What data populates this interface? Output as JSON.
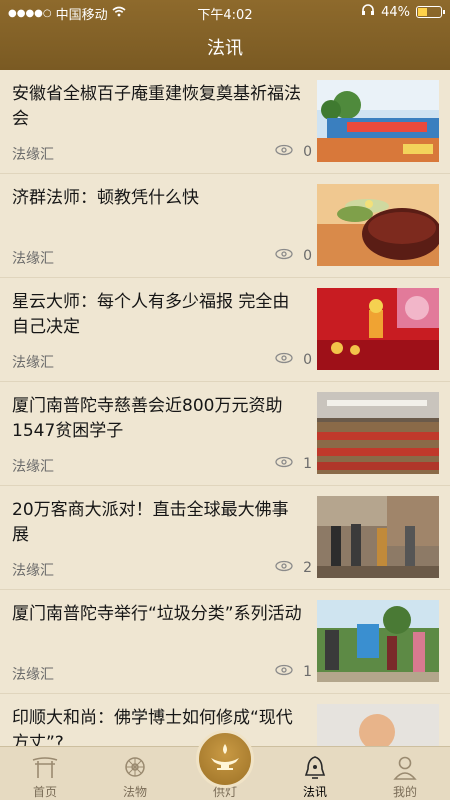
{
  "status_bar": {
    "signal": "●●●●○",
    "carrier": "中国移动",
    "time": "下午4:02",
    "battery": "44%",
    "battery_level": 0.44
  },
  "nav": {
    "title": "法讯"
  },
  "articles": [
    {
      "title": "安徽省全椒百子庵重建恢复奠基祈福法会",
      "source": "法缘汇",
      "views": "0",
      "thumb_icon": "ceremony-photo"
    },
    {
      "title": "济群法师：顿教凭什么快",
      "source": "法缘汇",
      "views": "0",
      "thumb_icon": "lotus-bowl-photo"
    },
    {
      "title": " 星云大师：每个人有多少福报 完全由自己决定",
      "source": "法缘汇",
      "views": "0",
      "thumb_icon": "lantern-photo"
    },
    {
      "title": "厦门南普陀寺慈善会近800万元资助1547贫困学子",
      "source": "法缘汇",
      "views": "1",
      "thumb_icon": "hall-meeting-photo"
    },
    {
      "title": "20万客商大派对！直击全球最大佛事展",
      "source": "法缘汇",
      "views": "2",
      "thumb_icon": "expo-crowd-photo"
    },
    {
      "title": "厦门南普陀寺举行“垃圾分类”系列活动",
      "source": "法缘汇",
      "views": "1",
      "thumb_icon": "outdoor-event-photo"
    },
    {
      "title": "印顺大和尚：佛学博士如何修成“现代方丈”?",
      "source": "",
      "views": "",
      "thumb_icon": "monk-portrait-photo"
    }
  ],
  "tabs": [
    {
      "label": "首页",
      "icon": "gate-icon"
    },
    {
      "label": "法物",
      "icon": "wheel-icon"
    },
    {
      "label": "供灯",
      "icon": "lamp-icon"
    },
    {
      "label": "法讯",
      "icon": "bell-icon",
      "active": true
    },
    {
      "label": "我的",
      "icon": "person-icon"
    }
  ],
  "colors": {
    "header": "#8e6a2c",
    "background": "#efe6d2",
    "tabbar": "#e6dac1",
    "accent": "#b5852f"
  }
}
